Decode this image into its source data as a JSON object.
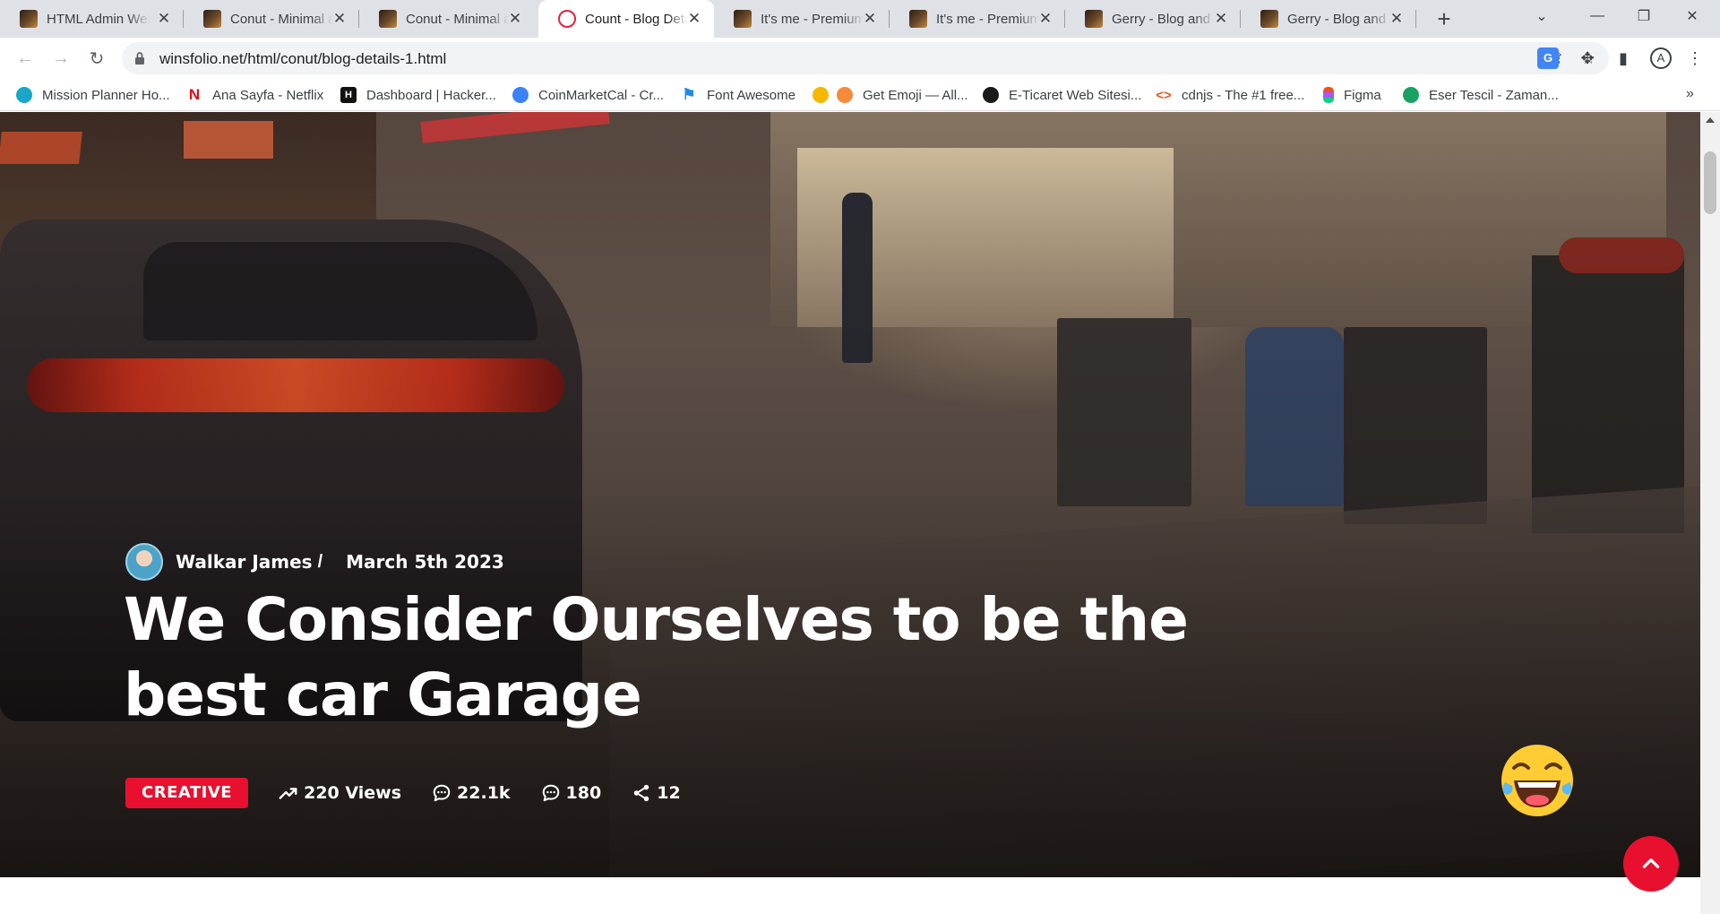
{
  "browser": {
    "tabs": [
      {
        "title": "HTML Admin Website",
        "active": false
      },
      {
        "title": "Conut - Minimal and",
        "active": false
      },
      {
        "title": "Conut - Minimal and",
        "active": false
      },
      {
        "title": "Count - Blog Details",
        "active": true
      },
      {
        "title": "It's me - Premium",
        "active": false
      },
      {
        "title": "It's me - Premium",
        "active": false
      },
      {
        "title": "Gerry - Blog and P",
        "active": false
      },
      {
        "title": "Gerry - Blog and P",
        "active": false
      }
    ],
    "url": "winsfolio.net/html/conut/blog-details-1.html",
    "bookmarks": [
      {
        "label": "Mission Planner Ho...",
        "icon": "mission-planner-icon",
        "color": "#19a6c7"
      },
      {
        "label": "Ana Sayfa - Netflix",
        "icon": "netflix-icon",
        "color": "#e50914"
      },
      {
        "label": "Dashboard | Hacker...",
        "icon": "hackerrank-icon",
        "color": "#111111"
      },
      {
        "label": "CoinMarketCal - Cr...",
        "icon": "coinmarketcal-icon",
        "color": "#3b82f6"
      },
      {
        "label": "Font Awesome",
        "icon": "flag-icon",
        "color": "#228ae6"
      },
      {
        "label": "Get Emoji — All...",
        "icon": "emoji-icon",
        "color": "#f5b800"
      },
      {
        "label": "E-Ticaret Web Sitesi...",
        "icon": "eticaret-icon",
        "color": "#1a1a1a"
      },
      {
        "label": "cdnjs - The #1 free...",
        "icon": "code-icon",
        "color": "#e95420"
      },
      {
        "label": "Figma",
        "icon": "figma-icon",
        "color": "#f24e1e"
      },
      {
        "label": "Eser Tescil - Zaman...",
        "icon": "eser-tescil-icon",
        "color": "#1aa260"
      }
    ]
  },
  "post": {
    "author": "Walkar James",
    "author_separator": "/",
    "date": "March 5th 2023",
    "title": "We Consider Ourselves to be the best car Garage",
    "category": "CREATIVE",
    "stats": {
      "views": "220 Views",
      "comments_a": "22.1k",
      "comments_b": "180",
      "shares": "12"
    }
  },
  "colors": {
    "accent": "#e8102e",
    "tabstrip": "#dee1e6"
  }
}
